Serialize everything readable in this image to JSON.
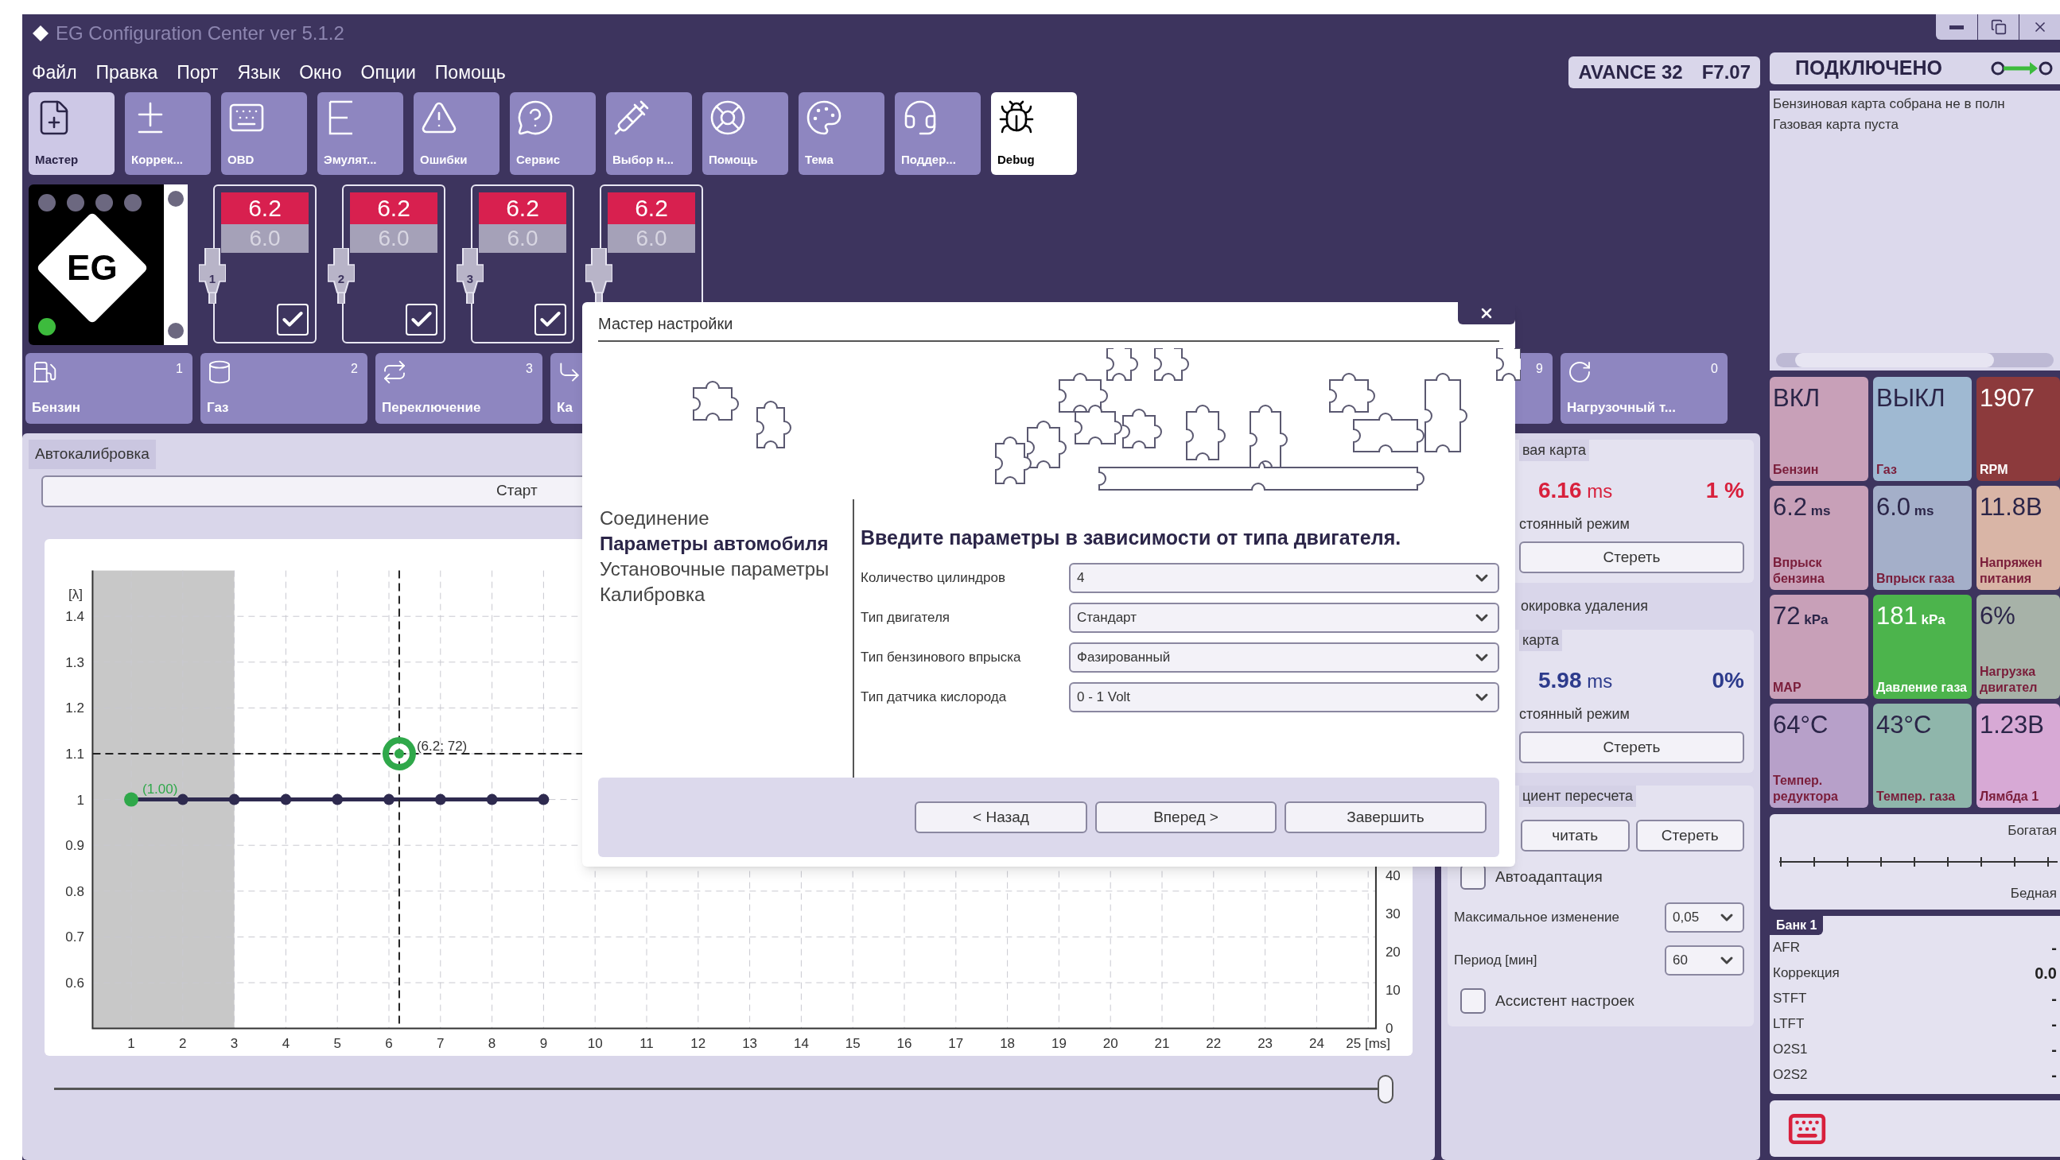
{
  "window": {
    "title": "EG Configuration Center ver 5.1.2"
  },
  "menu": [
    "Файл",
    "Правка",
    "Порт",
    "Язык",
    "Окно",
    "Опции",
    "Помощь"
  ],
  "toolbar": [
    {
      "label": "Мастер",
      "selected": true,
      "on": false
    },
    {
      "label": "Коррек...",
      "selected": false,
      "on": false
    },
    {
      "label": "OBD",
      "selected": false,
      "on": false
    },
    {
      "label": "Эмулят...",
      "selected": false,
      "on": false
    },
    {
      "label": "Ошибки",
      "selected": false,
      "on": false
    },
    {
      "label": "Сервис",
      "selected": false,
      "on": false
    },
    {
      "label": "Выбор н...",
      "selected": false,
      "on": false
    },
    {
      "label": "Помощь",
      "selected": false,
      "on": false
    },
    {
      "label": "Тема",
      "selected": false,
      "on": false
    },
    {
      "label": "Поддер...",
      "selected": false,
      "on": false
    },
    {
      "label": "Debug",
      "selected": false,
      "on": true
    }
  ],
  "device": {
    "model": "AVANCE 32",
    "firmware": "F7.07"
  },
  "connection": {
    "status": "ПОДКЛЮЧЕНО",
    "connected": true
  },
  "messages": [
    "Бензиновая карта собрана не в полн",
    "Газовая карта пуста"
  ],
  "logo": {
    "text": "EG",
    "online": true
  },
  "injectors": [
    {
      "number": "1",
      "petrol": "6.2",
      "gas": "6.0",
      "checked": true
    },
    {
      "number": "2",
      "petrol": "6.2",
      "gas": "6.0",
      "checked": true
    },
    {
      "number": "3",
      "petrol": "6.2",
      "gas": "6.0",
      "checked": true
    },
    {
      "petrol": "6.2",
      "gas": "6.0"
    }
  ],
  "tabs": [
    {
      "label": "Бензин",
      "count": "1"
    },
    {
      "label": "Газ",
      "count": "2"
    },
    {
      "label": "Переключение",
      "count": "3"
    },
    {
      "label": "Ка"
    },
    {
      "count": "9"
    },
    {
      "label": "Нагрузочный т...",
      "count": "0"
    }
  ],
  "autocalibration": {
    "title": "Автокалибровка",
    "button": "Старт"
  },
  "chart": {
    "right_axis_ticks": [
      "40",
      "30",
      "20",
      "10",
      "0"
    ],
    "chart_data": {
      "type": "line",
      "ylabel": "[λ]",
      "x": [
        1,
        2,
        3,
        4,
        5,
        6,
        7,
        8,
        9
      ],
      "series": [
        {
          "color": "#2e2a4f",
          "marker": "circle",
          "values": [
            1.0,
            1.0,
            1.0,
            1.0,
            1.0,
            1.0,
            1.0,
            1.0,
            1.0
          ]
        }
      ],
      "xlim": [
        0.25,
        25.15
      ],
      "ylim": [
        0.5,
        1.5
      ],
      "grid": true,
      "bands": [
        {
          "axis": "x",
          "from": 0.25,
          "to": 3
        }
      ],
      "xticks": [
        1,
        2,
        3,
        4,
        5,
        6,
        7,
        8,
        9,
        10,
        11,
        12,
        13,
        14,
        15,
        16,
        17,
        18,
        19,
        20,
        21,
        22,
        23,
        24,
        {
          "value": 25,
          "label": "25 [ms]"
        }
      ],
      "yticks": [
        0.6,
        0.7,
        0.8,
        0.9,
        1.0,
        1.1,
        1.2,
        1.3,
        1.4
      ],
      "ref_lines": [
        {
          "axis": "y",
          "value": 1.1
        },
        {
          "axis": "x",
          "value": 6.2
        }
      ],
      "annotations": [
        {
          "x": 6.2,
          "y": 1.1,
          "text": "(6.2; 72)"
        },
        {
          "x": 1,
          "y": 1.0,
          "text": "(1.00)"
        }
      ]
    }
  },
  "petrol_map": {
    "title": "вая карта",
    "time": "6.16",
    "unit": "ms",
    "percent": "1 %",
    "mode": "стоянный режим",
    "button": "Стереть"
  },
  "delete_lock": "окировка удаления",
  "gas_map": {
    "title": "карта",
    "time": "5.98",
    "unit": "ms",
    "percent": "0%",
    "mode": "стоянный режим",
    "button": "Стереть"
  },
  "recalc": {
    "title": "циент пересчета",
    "buttons": [
      "читать",
      "Стереть"
    ],
    "autoadapt": {
      "label": "Автоадаптация",
      "checked": false
    },
    "max_change": {
      "label": "Максимальное изменение",
      "value": "0,05"
    },
    "period": {
      "label": "Период [мин]",
      "value": "60"
    },
    "assistant": {
      "label": "Ассистент настроек",
      "checked": false
    }
  },
  "gauges": [
    {
      "reading": "ВКЛ",
      "caption": "Бензин",
      "color": "#c8a0b8"
    },
    {
      "reading": "ВЫКЛ",
      "caption": "Газ",
      "color": "#9fb9d2"
    },
    {
      "reading": "1907",
      "caption": "RPM",
      "color": "#8c3a3c"
    },
    {
      "reading": "6.2",
      "unit": "ms",
      "caption": "Впрыск бензина",
      "color": "#c8a0b8"
    },
    {
      "reading": "6.0",
      "unit": "ms",
      "caption": "Впрыск газа",
      "color": "#a4afc9"
    },
    {
      "reading": "11.8В",
      "caption": "Напряжен питания",
      "color": "#d9b5a6"
    },
    {
      "reading": "72",
      "unit": "kPa",
      "caption": "MAP",
      "color": "#c8a0b8"
    },
    {
      "reading": "181",
      "unit": "kPa",
      "caption": "Давление газа",
      "color": "#4cb44c"
    },
    {
      "reading": "6%",
      "caption": "Нагрузка двигател",
      "color": "#a7b2a8"
    },
    {
      "reading": "64°C",
      "caption": "Темпер. редуктора",
      "color": "#b7a0c9"
    },
    {
      "reading": "43°C",
      "caption": "Темпер. газа",
      "color": "#8fb6ab"
    },
    {
      "reading": "1.23В",
      "caption": "Лямбда 1",
      "color": "#d7a9d5"
    }
  ],
  "lambda": {
    "rich": "Богатая",
    "lean": "Бедная"
  },
  "bank": {
    "title": "Банк 1",
    "rows": [
      {
        "label": "AFR",
        "value": "-"
      },
      {
        "label": "Коррекция",
        "value": "0.0"
      },
      {
        "label": "STFT",
        "value": "-"
      },
      {
        "label": "LTFT",
        "value": "-"
      },
      {
        "label": "O2S1",
        "value": "-"
      },
      {
        "label": "O2S2",
        "value": "-"
      }
    ]
  },
  "dialog": {
    "title": "Мастер настройки",
    "steps": [
      {
        "label": "Соединение",
        "selected": false
      },
      {
        "label": "Параметры автомобиля",
        "selected": true
      },
      {
        "label": "Установочные параметры",
        "selected": false
      },
      {
        "label": "Калибровка",
        "selected": false
      }
    ],
    "heading": "Введите параметры в зависимости от типа двигателя.",
    "fields": [
      {
        "label": "Количество цилиндров",
        "value": "4"
      },
      {
        "label": "Тип двигателя",
        "value": "Стандарт"
      },
      {
        "label": "Тип бензинового впрыска",
        "value": "Фазированный"
      },
      {
        "label": "Тип датчика кислорода",
        "value": "0 - 1 Volt"
      }
    ],
    "buttons": [
      "< Назад",
      "Вперед >",
      "Завершить"
    ]
  }
}
